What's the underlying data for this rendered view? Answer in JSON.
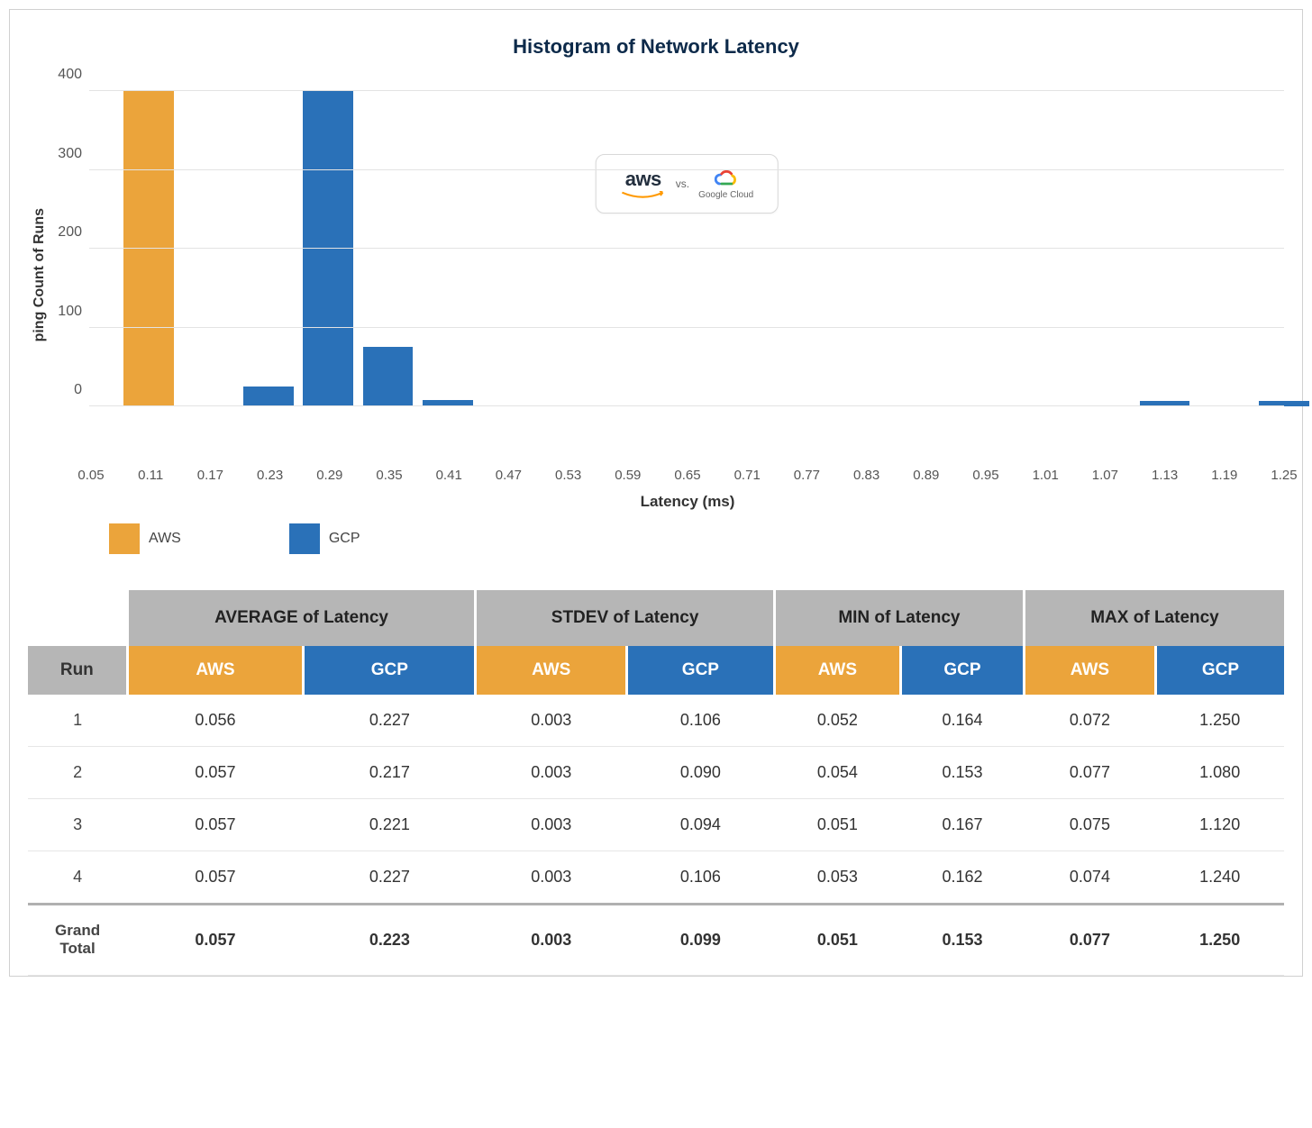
{
  "chart_data": {
    "type": "bar",
    "title": "Histogram of Network Latency",
    "xlabel": "Latency (ms)",
    "ylabel": "ping Count of Runs",
    "ylim": [
      0,
      400
    ],
    "y_ticks": [
      0,
      100,
      200,
      300,
      400
    ],
    "categories": [
      "0.05",
      "0.11",
      "0.17",
      "0.23",
      "0.29",
      "0.35",
      "0.41",
      "0.47",
      "0.53",
      "0.59",
      "0.65",
      "0.71",
      "0.77",
      "0.83",
      "0.89",
      "0.95",
      "1.01",
      "1.07",
      "1.13",
      "1.19",
      "1.25"
    ],
    "series": [
      {
        "name": "AWS",
        "color": "#eba43b",
        "values": [
          0,
          400,
          0,
          0,
          0,
          0,
          0,
          0,
          0,
          0,
          0,
          0,
          0,
          0,
          0,
          0,
          0,
          0,
          0,
          0,
          0
        ]
      },
      {
        "name": "GCP",
        "color": "#2a71b8",
        "values": [
          0,
          0,
          0,
          25,
          400,
          75,
          8,
          0,
          0,
          0,
          0,
          0,
          0,
          0,
          0,
          0,
          0,
          0,
          7,
          0,
          7
        ]
      }
    ],
    "legend": {
      "position": "bottom-left"
    }
  },
  "legend_labels": {
    "aws": "AWS",
    "gcp": "GCP"
  },
  "badge": {
    "aws_text": "aws",
    "vs": "vs.",
    "gcp_text": "Google Cloud"
  },
  "table": {
    "group_headers": [
      "AVERAGE of Latency",
      "STDEV of Latency",
      "MIN of Latency",
      "MAX of Latency"
    ],
    "run_header": "Run",
    "provider_labels": {
      "aws": "AWS",
      "gcp": "GCP"
    },
    "rows": [
      {
        "run": "1",
        "avg_aws": "0.056",
        "avg_gcp": "0.227",
        "std_aws": "0.003",
        "std_gcp": "0.106",
        "min_aws": "0.052",
        "min_gcp": "0.164",
        "max_aws": "0.072",
        "max_gcp": "1.250"
      },
      {
        "run": "2",
        "avg_aws": "0.057",
        "avg_gcp": "0.217",
        "std_aws": "0.003",
        "std_gcp": "0.090",
        "min_aws": "0.054",
        "min_gcp": "0.153",
        "max_aws": "0.077",
        "max_gcp": "1.080"
      },
      {
        "run": "3",
        "avg_aws": "0.057",
        "avg_gcp": "0.221",
        "std_aws": "0.003",
        "std_gcp": "0.094",
        "min_aws": "0.051",
        "min_gcp": "0.167",
        "max_aws": "0.075",
        "max_gcp": "1.120"
      },
      {
        "run": "4",
        "avg_aws": "0.057",
        "avg_gcp": "0.227",
        "std_aws": "0.003",
        "std_gcp": "0.106",
        "min_aws": "0.053",
        "min_gcp": "0.162",
        "max_aws": "0.074",
        "max_gcp": "1.240"
      }
    ],
    "grand_total": {
      "label": "Grand Total",
      "avg_aws": "0.057",
      "avg_gcp": "0.223",
      "std_aws": "0.003",
      "std_gcp": "0.099",
      "min_aws": "0.051",
      "min_gcp": "0.153",
      "max_aws": "0.077",
      "max_gcp": "1.250"
    }
  }
}
